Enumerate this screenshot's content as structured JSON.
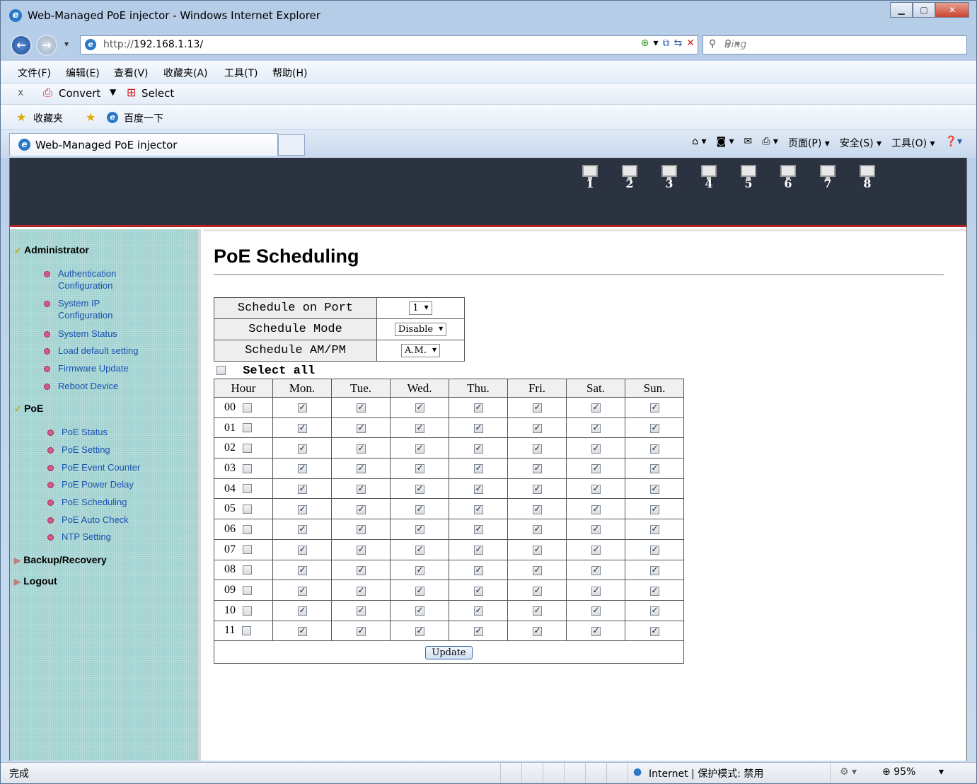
{
  "window": {
    "title": "Web-Managed PoE injector - Windows Internet Explorer"
  },
  "address": {
    "url_prefix": "http://",
    "url_host": "192.168.1.13/",
    "search_placeholder": "Bing"
  },
  "menu": [
    "文件(F)",
    "编辑(E)",
    "查看(V)",
    "收藏夹(A)",
    "工具(T)",
    "帮助(H)"
  ],
  "convert_bar": {
    "close": "x",
    "convert": "Convert",
    "select": "Select"
  },
  "favorites_bar": {
    "favorites": "收藏夹",
    "baidu": "百度一下"
  },
  "tab": {
    "title": "Web-Managed PoE injector"
  },
  "command_bar": [
    "页面(P) ▾",
    "安全(S) ▾",
    "工具(O) ▾"
  ],
  "banner": {
    "ports": [
      "1",
      "2",
      "3",
      "4",
      "5",
      "6",
      "7",
      "8"
    ]
  },
  "sidebar": {
    "admin": "Administrator",
    "admin_items": [
      "Authentication Configuration",
      "System IP Configuration",
      "System Status",
      "Load default setting",
      "Firmware Update",
      "Reboot Device"
    ],
    "poe": "PoE",
    "poe_items": [
      "PoE Status",
      "PoE Setting",
      "PoE Event Counter",
      "PoE Power Delay",
      "PoE Scheduling",
      "PoE Auto Check",
      "NTP Setting"
    ],
    "backup": "Backup/Recovery",
    "logout": "Logout"
  },
  "content": {
    "title": "PoE Scheduling",
    "port_label": "Schedule on Port",
    "port_value": "1",
    "mode_label": "Schedule Mode",
    "mode_value": "Disable",
    "ampm_label": "Schedule AM/PM",
    "ampm_value": "A.M.",
    "select_all": "Select all",
    "columns": [
      "Hour",
      "Mon.",
      "Tue.",
      "Wed.",
      "Thu.",
      "Fri.",
      "Sat.",
      "Sun."
    ],
    "hours": [
      "00",
      "01",
      "02",
      "03",
      "04",
      "05",
      "06",
      "07",
      "08",
      "09",
      "10",
      "11"
    ],
    "hour_checked": false,
    "day_checked": true,
    "update": "Update"
  },
  "status": {
    "left": "完成",
    "zone": "Internet | 保护模式: 禁用",
    "zoom": "95%"
  }
}
